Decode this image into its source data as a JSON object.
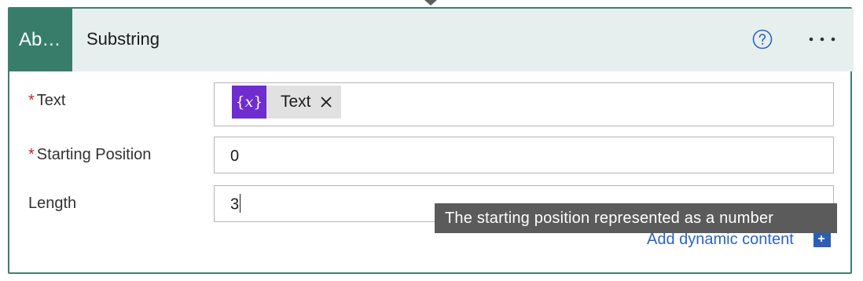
{
  "action": {
    "icon_text": "Ab…",
    "title": "Substring",
    "help_icon": "help-circle-icon",
    "more_icon": "more-horizontal-icon"
  },
  "fields": {
    "text": {
      "required_mark": "*",
      "label": "Text",
      "token": {
        "icon_glyph": "{𝑥}",
        "icon_name": "variable-icon",
        "label": "Text",
        "remove_icon": "close-icon"
      }
    },
    "starting_position": {
      "required_mark": "*",
      "label": "Starting Position",
      "value": "0"
    },
    "length": {
      "label": "Length",
      "value": "3"
    }
  },
  "tooltip": {
    "text": "The starting position represented as a number"
  },
  "dynamic_content": {
    "link_label": "Add dynamic content",
    "icon_glyph": "+"
  },
  "colors": {
    "accent_green": "#377d6a",
    "header_bg": "#e6efee",
    "token_purple": "#6f2ccf",
    "link_blue": "#2b63c6",
    "required_red": "#c4262e"
  }
}
